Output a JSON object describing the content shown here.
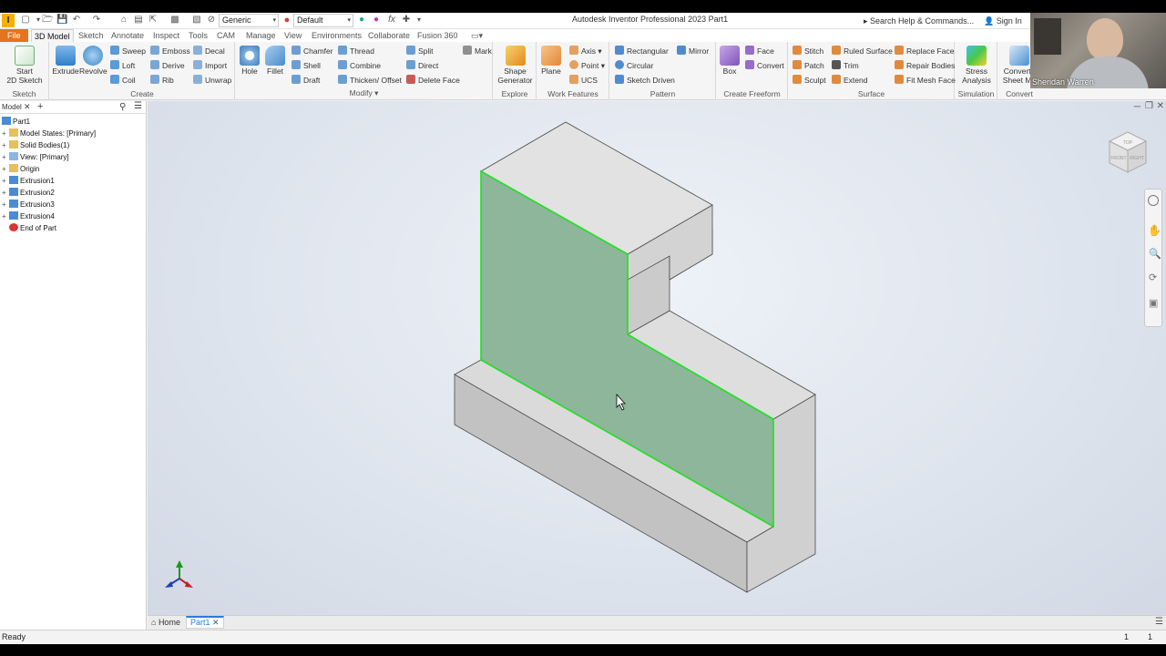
{
  "qat": {
    "app_icon_letter": "I",
    "material": "Generic",
    "appearance": "Default",
    "fx": "fx"
  },
  "title": "Autodesk Inventor Professional 2023   Part1",
  "search_placeholder": "Search Help & Commands...",
  "signin": "Sign In",
  "tabs": [
    "File",
    "3D Model",
    "Sketch",
    "Annotate",
    "Inspect",
    "Tools",
    "CAM",
    "Manage",
    "View",
    "Environments",
    "Collaborate",
    "Fusion 360"
  ],
  "ribbon": {
    "sketch": {
      "label": "Sketch",
      "start_line1": "Start",
      "start_line2": "2D Sketch"
    },
    "create": {
      "label": "Create",
      "extrude": "Extrude",
      "revolve": "Revolve",
      "sweep": "Sweep",
      "loft": "Loft",
      "coil": "Coil",
      "emboss": "Emboss",
      "derive": "Derive",
      "rib": "Rib",
      "decal": "Decal",
      "import": "Import",
      "unwrap": "Unwrap"
    },
    "modify": {
      "label": "Modify",
      "hole": "Hole",
      "fillet": "Fillet",
      "chamfer": "Chamfer",
      "shell": "Shell",
      "draft": "Draft",
      "thread": "Thread",
      "combine": "Combine",
      "thicken": "Thicken/ Offset",
      "split": "Split",
      "direct": "Direct",
      "delete_face": "Delete Face",
      "mark": "Mark"
    },
    "explore": {
      "label": "Explore",
      "shape_line1": "Shape",
      "shape_line2": "Generator"
    },
    "work": {
      "label": "Work Features",
      "plane": "Plane",
      "axis": "Axis",
      "point": "Point",
      "ucs": "UCS"
    },
    "pattern": {
      "label": "Pattern",
      "rectangular": "Rectangular",
      "circular": "Circular",
      "sketch_driven": "Sketch Driven",
      "mirror": "Mirror"
    },
    "freeform": {
      "label": "Create Freeform",
      "box": "Box",
      "face": "Face",
      "convert": "Convert"
    },
    "surface": {
      "label": "Surface",
      "stitch": "Stitch",
      "patch": "Patch",
      "sculpt": "Sculpt",
      "ruled": "Ruled Surface",
      "trim": "Trim",
      "extend": "Extend",
      "replace_face": "Replace Face",
      "repair": "Repair Bodies",
      "fit_mesh": "Fit Mesh Face"
    },
    "simulation": {
      "label": "Simulation",
      "stress_line1": "Stress",
      "stress_line2": "Analysis"
    },
    "convert": {
      "label": "Convert",
      "line1": "Convert t",
      "line2": "Sheet Me"
    }
  },
  "browser": {
    "tab": "Model",
    "root": "Part1",
    "nodes": [
      "Model States: [Primary]",
      "Solid Bodies(1)",
      "View: [Primary]",
      "Origin",
      "Extrusion1",
      "Extrusion2",
      "Extrusion3",
      "Extrusion4",
      "End of Part"
    ]
  },
  "viewcube": {
    "front": "FRONT",
    "right": "RIGHT",
    "top": "TOP"
  },
  "doc_tabs": {
    "home": "Home",
    "part": "Part1"
  },
  "status": {
    "left": "Ready",
    "count1": "1",
    "count2": "1"
  },
  "webcam": {
    "name": "Sheridan Warren"
  },
  "colors": {
    "accent_orange": "#e7731c",
    "selection_green": "#21e021",
    "face_highlight": "#7fb491",
    "solid_gray": "#c8c8c8"
  }
}
